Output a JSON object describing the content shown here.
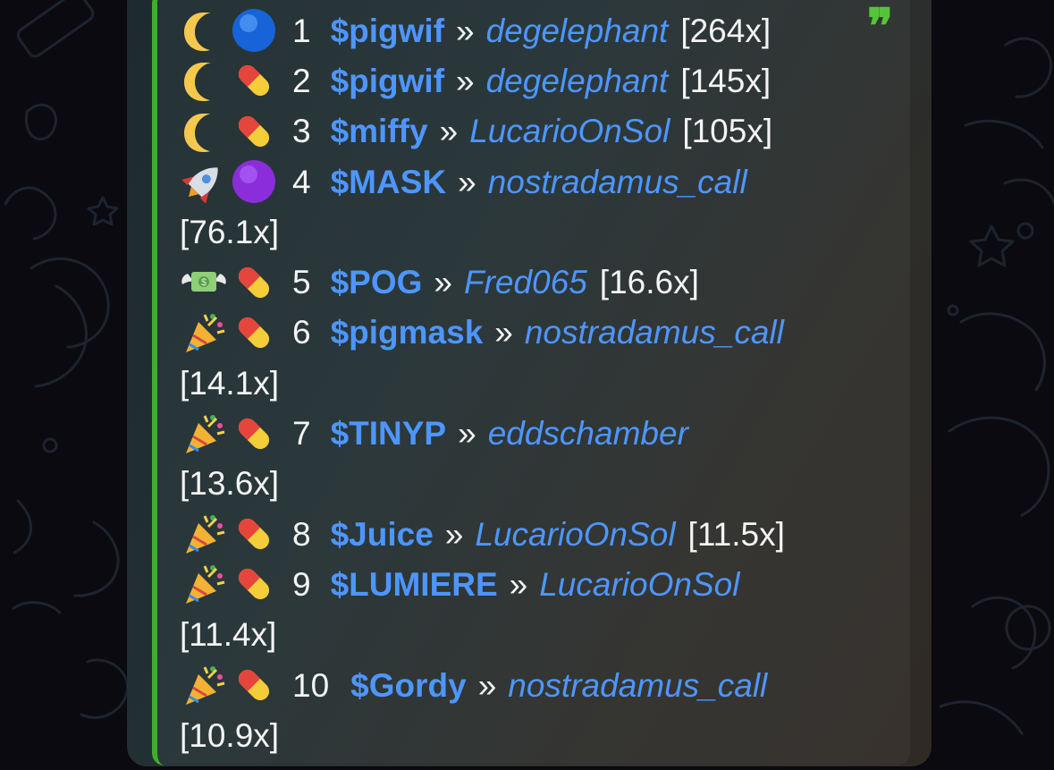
{
  "theme": {
    "accent_green": "#3fae2b",
    "link_blue": "#4d96ff",
    "text_white": "#f4f4f4"
  },
  "leaderboard": [
    {
      "rank": "1",
      "emojis": [
        "moon-icon",
        "blue-circle-icon"
      ],
      "ticker": "$pigwif",
      "separator": "»",
      "caller": "degelephant",
      "multiplier": "[264x]"
    },
    {
      "rank": "2",
      "emojis": [
        "moon-icon",
        "pill-icon"
      ],
      "ticker": "$pigwif",
      "separator": "»",
      "caller": "degelephant",
      "multiplier": "[145x]"
    },
    {
      "rank": "3",
      "emojis": [
        "moon-icon",
        "pill-icon"
      ],
      "ticker": "$miffy",
      "separator": "»",
      "caller": "LucarioOnSol",
      "multiplier": "[105x]"
    },
    {
      "rank": "4",
      "emojis": [
        "rocket-icon",
        "purple-circle-icon"
      ],
      "ticker": "$MASK",
      "separator": "»",
      "caller": "nostradamus_call",
      "multiplier": "[76.1x]"
    },
    {
      "rank": "5",
      "emojis": [
        "money-wings-icon",
        "pill-icon"
      ],
      "ticker": "$POG",
      "separator": "»",
      "caller": "Fred065",
      "multiplier": "[16.6x]"
    },
    {
      "rank": "6",
      "emojis": [
        "party-popper-icon",
        "pill-icon"
      ],
      "ticker": "$pigmask",
      "separator": "»",
      "caller": "nostradamus_call",
      "multiplier": "[14.1x]"
    },
    {
      "rank": "7",
      "emojis": [
        "party-popper-icon",
        "pill-icon"
      ],
      "ticker": "$TINYP",
      "separator": "»",
      "caller": "eddschamber",
      "multiplier": "[13.6x]"
    },
    {
      "rank": "8",
      "emojis": [
        "party-popper-icon",
        "pill-icon"
      ],
      "ticker": "$Juice",
      "separator": "»",
      "caller": "LucarioOnSol",
      "multiplier": "[11.5x]"
    },
    {
      "rank": "9",
      "emojis": [
        "party-popper-icon",
        "pill-icon"
      ],
      "ticker": "$LUMIERE",
      "separator": "»",
      "caller": "LucarioOnSol",
      "multiplier": "[11.4x]"
    },
    {
      "rank": "10",
      "emojis": [
        "party-popper-icon",
        "pill-icon"
      ],
      "ticker": "$Gordy",
      "separator": "»",
      "caller": "nostradamus_call",
      "multiplier": "[10.9x]"
    }
  ]
}
